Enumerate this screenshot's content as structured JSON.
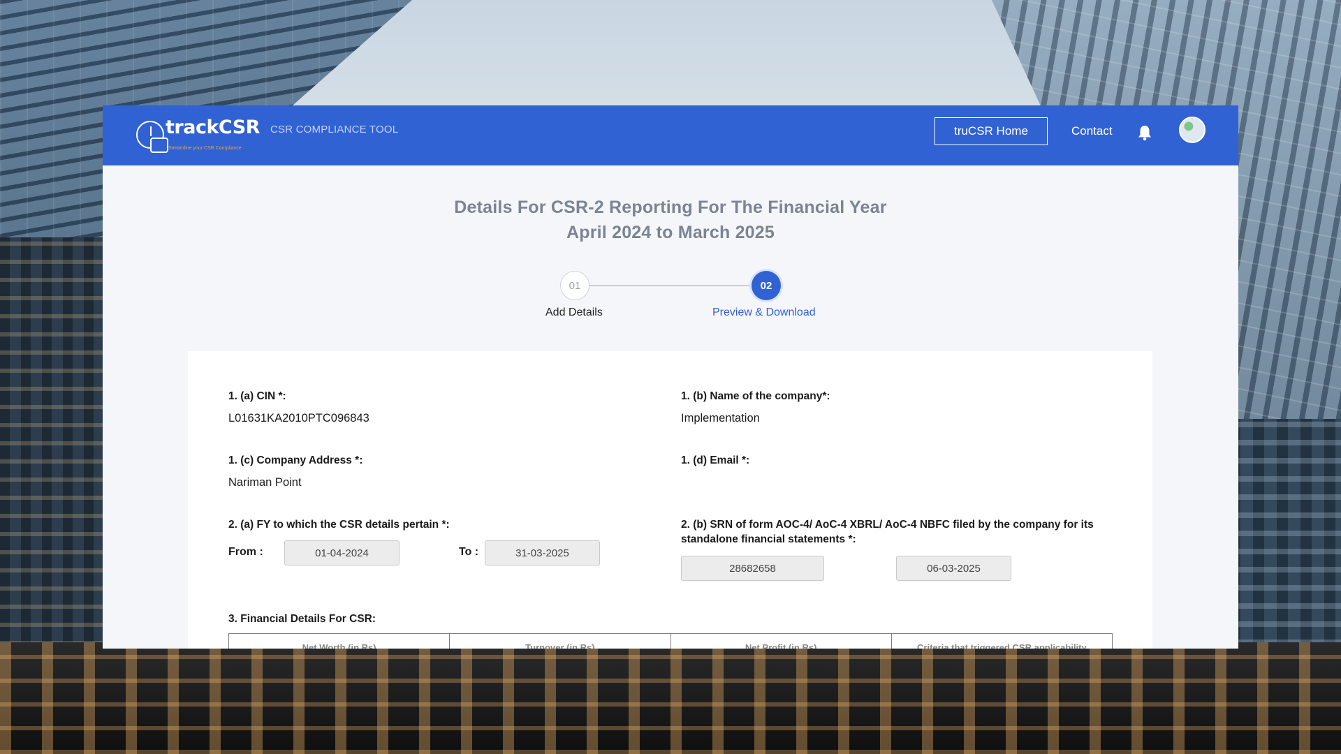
{
  "header": {
    "logo_text": "trackCSR",
    "logo_tagline": "Streamline your CSR Compliance",
    "tool_label": "CSR COMPLIANCE TOOL",
    "home_button": "truCSR Home",
    "contact_link": "Contact"
  },
  "page": {
    "title_line1": "Details For CSR-2 Reporting For The Financial Year",
    "title_line2": "April 2024 to March 2025"
  },
  "stepper": {
    "steps": [
      {
        "number": "01",
        "label": "Add Details"
      },
      {
        "number": "02",
        "label": "Preview & Download"
      }
    ],
    "active_step": "02"
  },
  "form": {
    "cin": {
      "label": "1. (a) CIN *:",
      "value": "L01631KA2010PTC096843"
    },
    "company_name": {
      "label": "1. (b) Name of the company*:",
      "value": "Implementation"
    },
    "address": {
      "label": "1. (c) Company Address *:",
      "value": "Nariman Point"
    },
    "email": {
      "label": "1. (d) Email *:",
      "value": ""
    },
    "fy": {
      "label": "2. (a) FY to which the CSR details pertain *:",
      "from_label": "From :",
      "from_value": "01-04-2024",
      "to_label": "To :",
      "to_value": "31-03-2025"
    },
    "srn": {
      "label_line1": "2. (b) SRN of form AOC-4/ AoC-4 XBRL/ AoC-4 NBFC filed by the company for its",
      "label_line2": "standalone financial statements *:",
      "srn_value": "28682658",
      "date_value": "06-03-2025"
    },
    "financial": {
      "label": "3. Financial Details For CSR:",
      "columns": [
        "Net Worth (in Rs)",
        "Turnover (in Rs)",
        "Net Profit (in Rs)",
        "Criteria that triggered CSR applicability"
      ]
    }
  },
  "colors": {
    "primary": "#3162d3",
    "title_gray": "#7c8392",
    "field_bg": "#ececec"
  }
}
